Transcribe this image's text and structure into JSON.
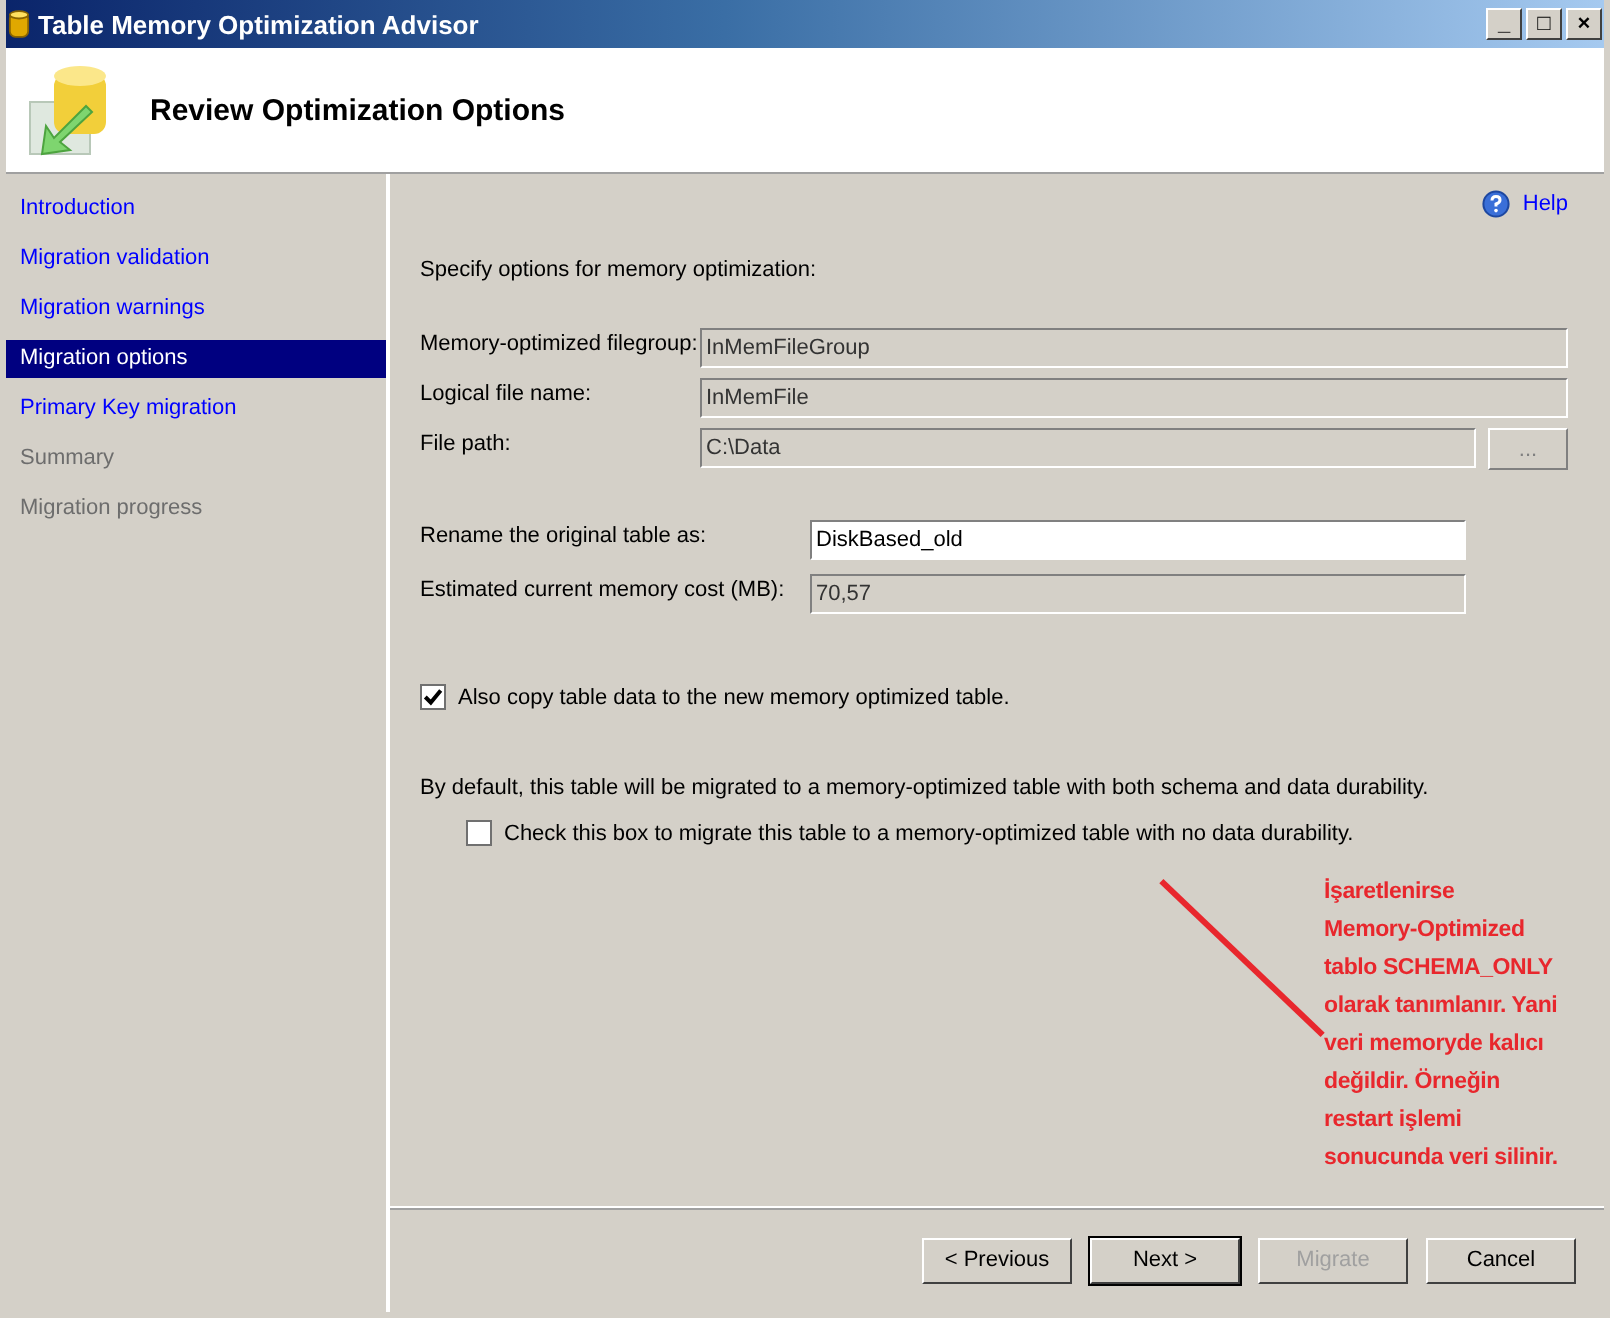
{
  "window": {
    "title": "Table Memory Optimization Advisor",
    "controls": [
      "_",
      "□",
      "×"
    ]
  },
  "header": {
    "title": "Review Optimization Options"
  },
  "sidebar": {
    "items": [
      {
        "label": "Introduction",
        "selected": false,
        "disabled": false
      },
      {
        "label": "Migration validation",
        "selected": false,
        "disabled": false
      },
      {
        "label": "Migration warnings",
        "selected": false,
        "disabled": false
      },
      {
        "label": "Migration options",
        "selected": true,
        "disabled": false
      },
      {
        "label": "Primary Key migration",
        "selected": false,
        "disabled": false
      },
      {
        "label": "Summary",
        "selected": false,
        "disabled": true
      },
      {
        "label": "Migration progress",
        "selected": false,
        "disabled": true
      }
    ]
  },
  "help": {
    "label": "Help"
  },
  "intro": "Specify options for memory optimization:",
  "fields": [
    {
      "label": "Memory-optimized filegroup:",
      "value": "InMemFileGroup",
      "browse": false
    },
    {
      "label": "Logical file name:",
      "value": "InMemFile",
      "browse": false
    },
    {
      "label": "File path:",
      "value": "C:\\Data",
      "browse": true,
      "browse_label": "..."
    }
  ],
  "rename_fields": [
    {
      "label": "Rename the original table as:",
      "value": "DiskBased_old",
      "editable": true
    },
    {
      "label": "Estimated current memory cost (MB):",
      "value": "70,57",
      "editable": false
    }
  ],
  "copy_data": {
    "label": "Also copy table data to the new memory optimized table.",
    "checked": true
  },
  "durability_note": "By default, this table will be migrated to a memory-optimized table with both schema and data durability.",
  "no_durability": {
    "label": "Check this box to migrate this table to a memory-optimized table with no data durability.",
    "checked": false
  },
  "annotation": {
    "lines": [
      "İşaretlenirse",
      "Memory-Optimized",
      "tablo SCHEMA_ONLY",
      "olarak tanımlanır. Yani",
      "veri memoryde kalıcı",
      "değildir. Örneğin",
      "restart işlemi",
      "sonucunda veri silinir."
    ]
  },
  "buttons": [
    {
      "label": "< Previous",
      "disabled": false,
      "default": false
    },
    {
      "label": "Next >",
      "disabled": false,
      "default": true
    },
    {
      "label": "Migrate",
      "disabled": true,
      "default": false
    },
    {
      "label": "Cancel",
      "disabled": false,
      "default": false
    }
  ]
}
